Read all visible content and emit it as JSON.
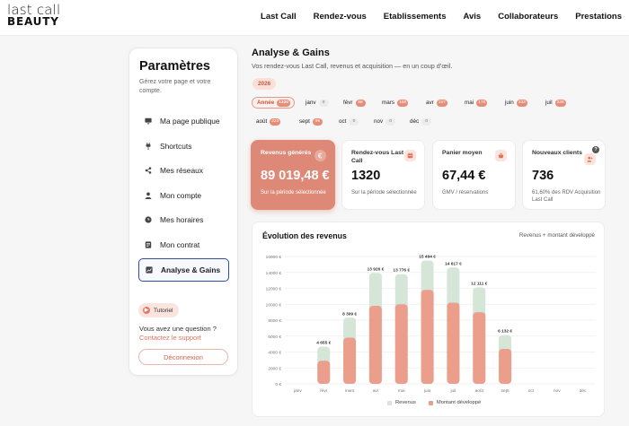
{
  "brand": {
    "line1": "last call",
    "line2": "BEAUTY"
  },
  "nav": [
    "Last Call",
    "Rendez-vous",
    "Etablissements",
    "Avis",
    "Collaborateurs",
    "Prestations"
  ],
  "sidebar": {
    "title": "Paramètres",
    "subtitle": "Gérez votre page et votre compte.",
    "items": [
      {
        "label": "Ma page publique",
        "icon": "monitor-icon"
      },
      {
        "label": "Shortcuts",
        "icon": "plug-icon"
      },
      {
        "label": "Mes réseaux",
        "icon": "share-icon"
      },
      {
        "label": "Mon compte",
        "icon": "user-icon"
      },
      {
        "label": "Mes horaires",
        "icon": "clock-icon"
      },
      {
        "label": "Mon contrat",
        "icon": "document-icon"
      },
      {
        "label": "Analyse & Gains",
        "icon": "chart-icon",
        "active": true
      }
    ],
    "tutorial": "Tutoriel",
    "question": "Vous avez une question ?",
    "support": "Contactez le support",
    "logout": "Déconnexion"
  },
  "main": {
    "title": "Analyse & Gains",
    "subtitle": "Vos rendez-vous Last Call, revenus et acquisition — en un coup d’œil.",
    "year": "2026",
    "periods": [
      {
        "label": "Année",
        "count": "1320",
        "active": true
      },
      {
        "label": "janv",
        "count": "0"
      },
      {
        "label": "févr",
        "count": "88"
      },
      {
        "label": "mars",
        "count": "169"
      },
      {
        "label": "avr",
        "count": "197"
      },
      {
        "label": "mai",
        "count": "175"
      },
      {
        "label": "juin",
        "count": "233"
      },
      {
        "label": "juil",
        "count": "226"
      },
      {
        "label": "août",
        "count": "223"
      },
      {
        "label": "sept",
        "count": "99"
      },
      {
        "label": "oct",
        "count": "0"
      },
      {
        "label": "nov",
        "count": "0"
      },
      {
        "label": "déc",
        "count": "0"
      }
    ]
  },
  "kpis": [
    {
      "title": "Revenus générés",
      "value": "89 019,48 €",
      "sub": "Sur la période sélectionnée",
      "icon": "euro-icon",
      "highlight": true
    },
    {
      "title": "Rendez-vous Last Call",
      "value": "1320",
      "sub": "Sur la période sélectionnée",
      "icon": "calendar-icon"
    },
    {
      "title": "Panier moyen",
      "value": "67,44 €",
      "sub": "GMV / réservations",
      "icon": "basket-icon"
    },
    {
      "title": "Nouveaux clients",
      "value": "736",
      "sub": "61,60% des RDV Acquisition Last Call",
      "icon": "add-user-icon",
      "help": "?"
    }
  ],
  "chart_title": "Évolution des revenus",
  "chart_note": "Revenus + montant développé",
  "colors": {
    "accent": "#e0735d",
    "revenue": "#ec9e8d",
    "developed": "#d5e6d9"
  },
  "chart_data": {
    "type": "bar",
    "stacked": true,
    "categories": [
      "janv",
      "févr",
      "mars",
      "avr",
      "mai",
      "juin",
      "juil",
      "août",
      "sept",
      "oct",
      "nov",
      "déc"
    ],
    "series": [
      {
        "name": "Revenus",
        "values": [
          0,
          2900,
          5800,
          9800,
          10000,
          11800,
          10200,
          9000,
          4400,
          0,
          0,
          0
        ]
      },
      {
        "name": "Montant développé",
        "values": [
          0,
          1755,
          2509,
          4126,
          3776,
          3694,
          4417,
          3111,
          1732,
          0,
          0,
          0
        ]
      }
    ],
    "totals": [
      0,
      4655,
      8309,
      13926,
      13776,
      15494,
      14617,
      12111,
      6132,
      0,
      0,
      0
    ],
    "total_labels": [
      "",
      "4 655 €",
      "8 309 €",
      "13 926 €",
      "13 776 €",
      "15 494 €",
      "14 617 €",
      "12 111 €",
      "6 132 €",
      "",
      "",
      ""
    ],
    "y_ticks": [
      "0 €",
      "2000 €",
      "4000 €",
      "6000 €",
      "8000 €",
      "10000 €",
      "12000 €",
      "14000 €",
      "16000 €"
    ],
    "ylim": [
      0,
      16000
    ],
    "grid": true,
    "legend": "bottom"
  }
}
